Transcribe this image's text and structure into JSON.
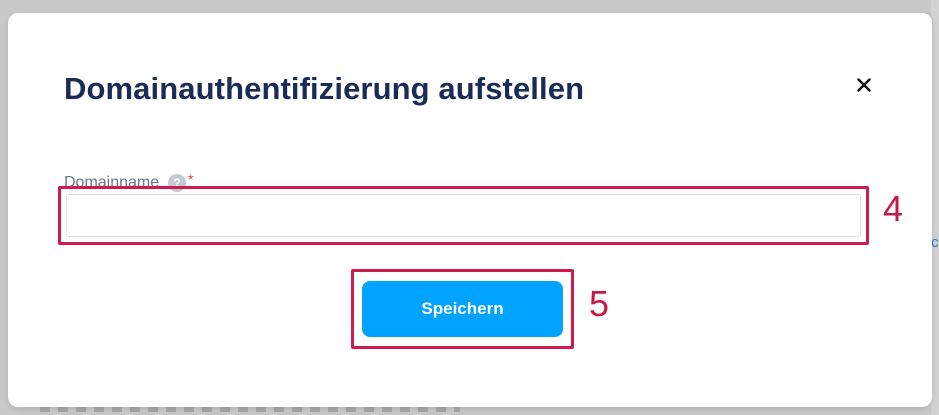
{
  "modal": {
    "title": "Domainauthentifizierung aufstellen",
    "close_icon": "close-icon"
  },
  "form": {
    "domain_label": "Domainname",
    "help_icon": "help-icon",
    "help_glyph": "?",
    "required_mark": "*",
    "domain_value": "",
    "domain_placeholder": ""
  },
  "actions": {
    "save_label": "Speichern"
  },
  "annotations": {
    "input_marker": "4",
    "button_marker": "5"
  },
  "colors": {
    "title": "#1b2b58",
    "accent_button": "#00a3ff",
    "annotation_red": "#d11a4f",
    "required": "#e23b58"
  }
}
